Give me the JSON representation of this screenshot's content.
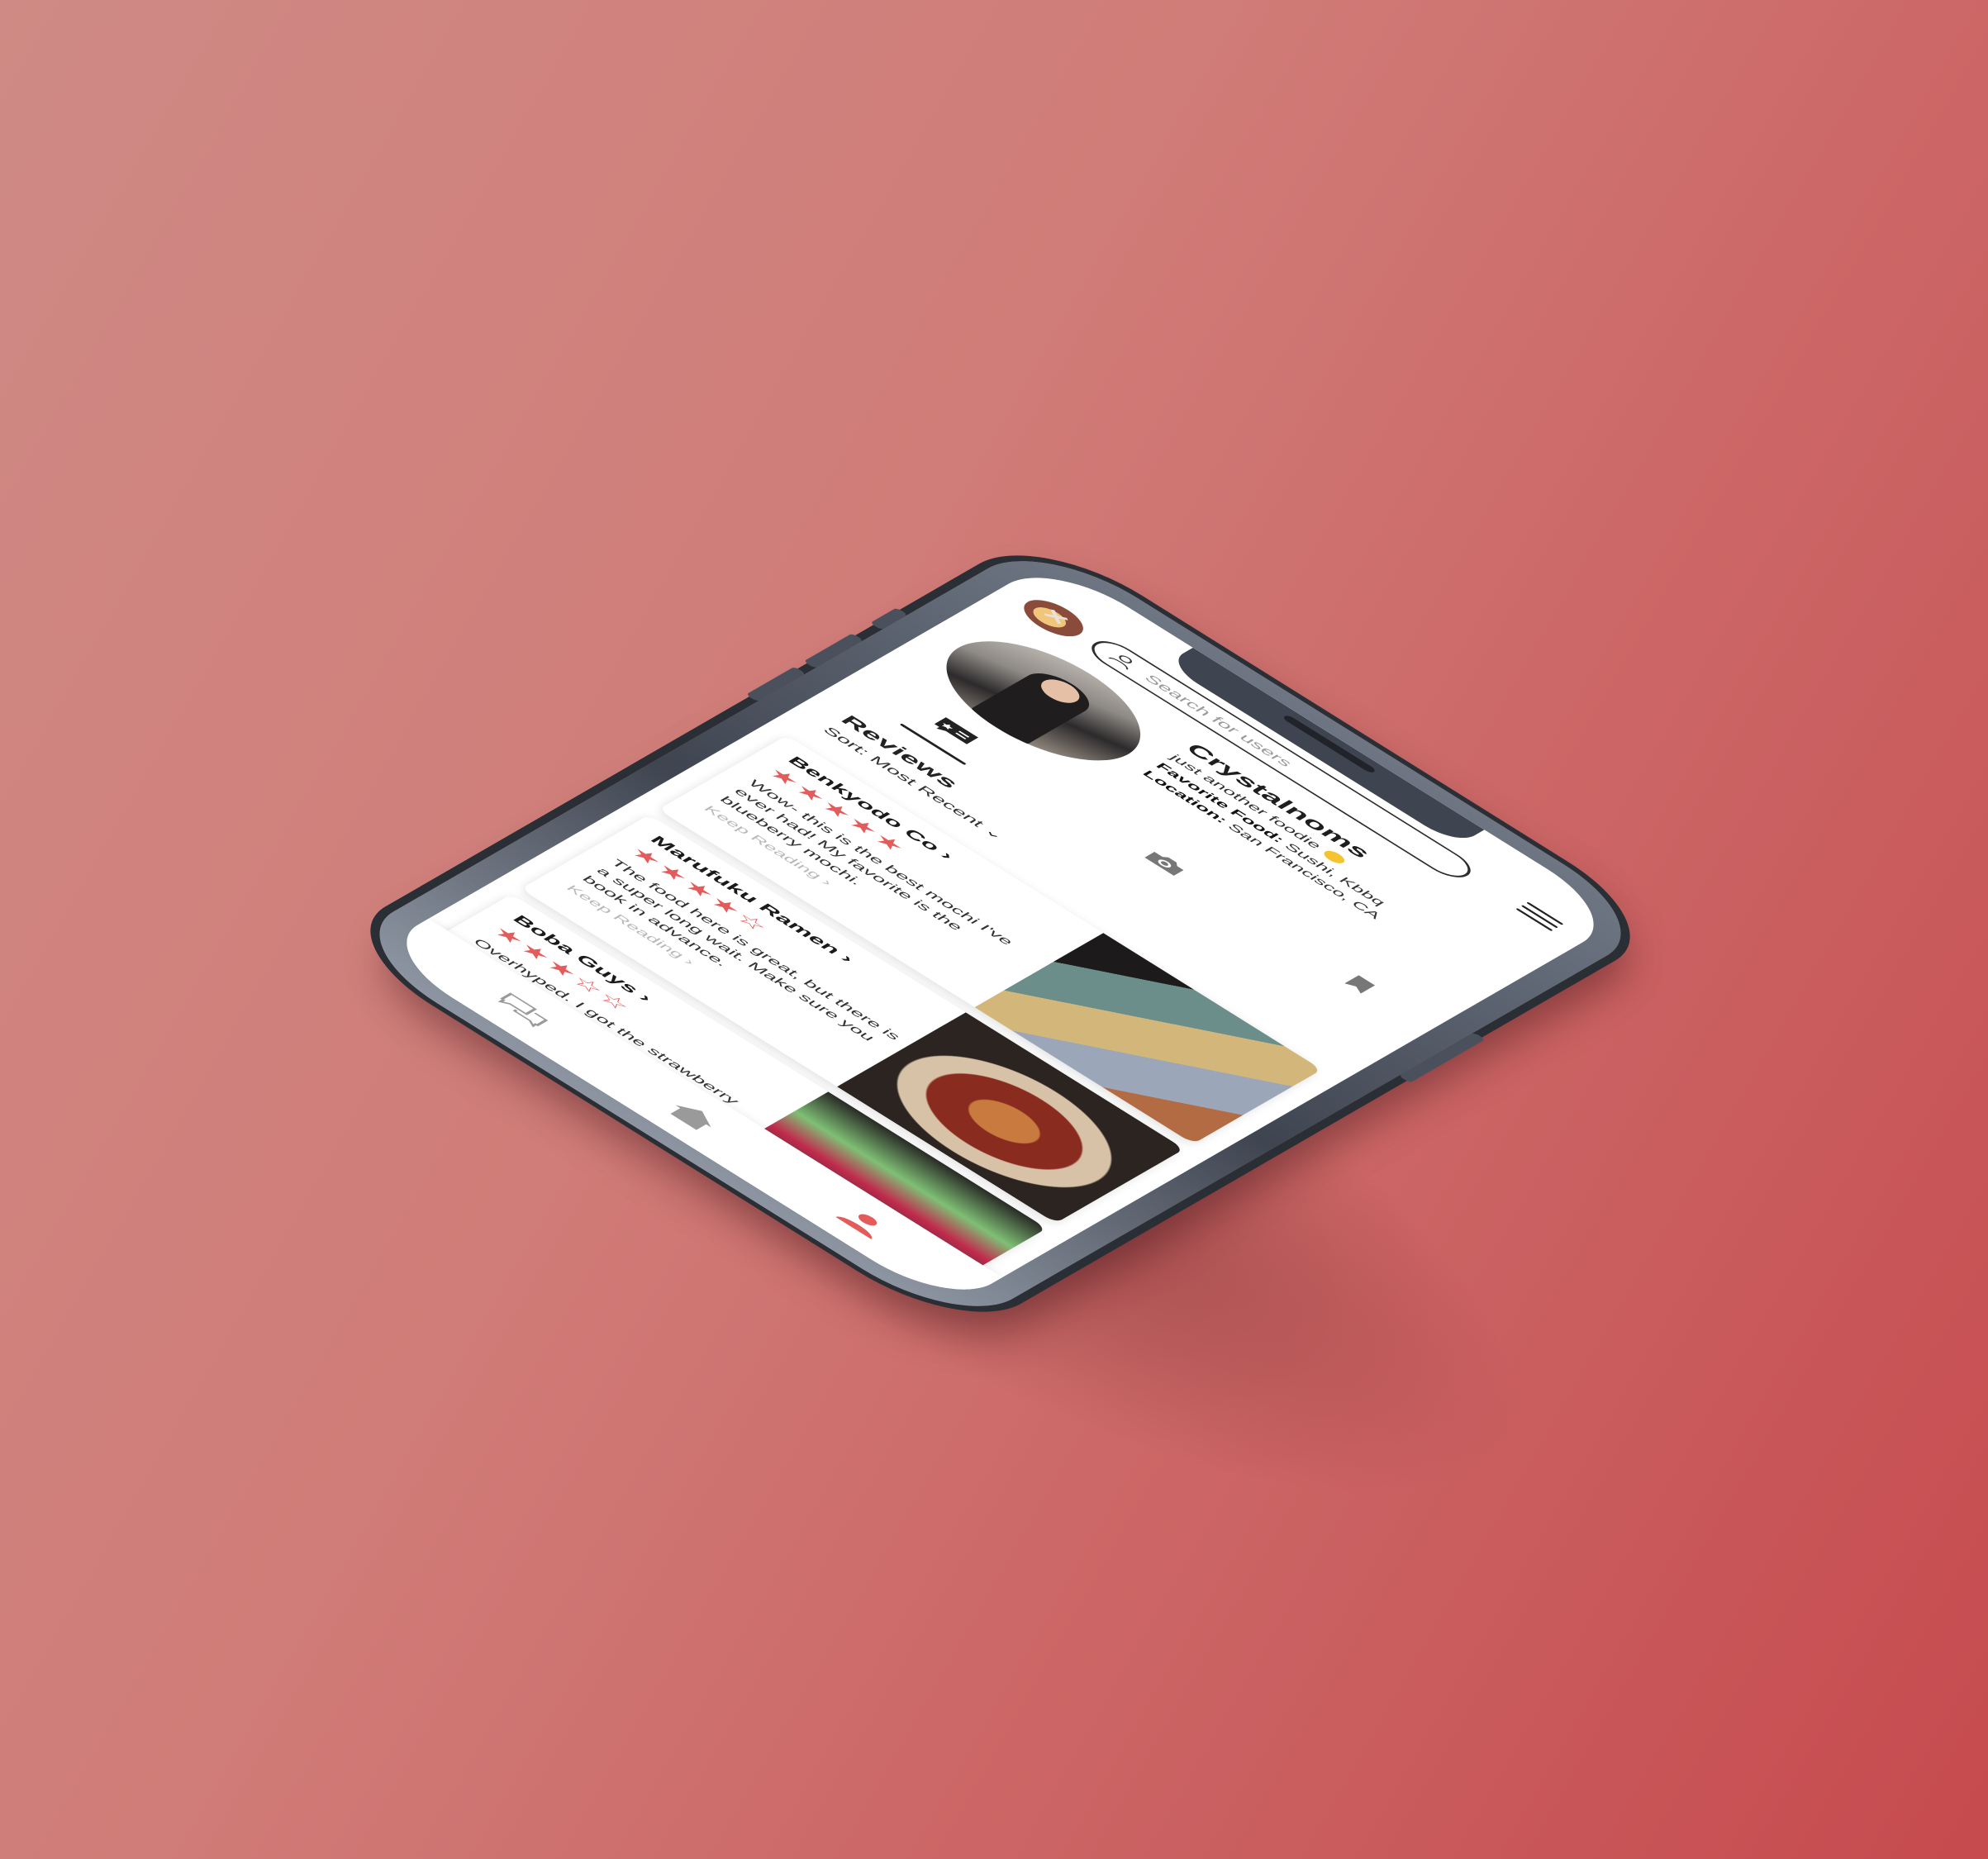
{
  "search": {
    "placeholder": "Search for users"
  },
  "profile": {
    "username": "Crystalnoms",
    "bio": "just another foodie",
    "favorite_food_label": "Favorite Food:",
    "favorite_food_value": "Sushi, Kbbq",
    "location_label": "Location:",
    "location_value": "San Francisco, CA"
  },
  "reviews_section": {
    "title": "Reviews",
    "sort_label": "Sort: Most Recent"
  },
  "reviews": [
    {
      "name": "Benkyodo Co",
      "rating": 5,
      "stars": "★★★★★",
      "text": "Wow- this is the best mochi I've ever had! My favorite is the blueberry mochi.",
      "more": "Keep Reading"
    },
    {
      "name": "Marufuku Ramen",
      "rating": 4,
      "stars": "★★★★☆",
      "text": "The food here is great, but there is a super long wait. Make sure you book in advance.",
      "more": "Keep Reading"
    },
    {
      "name": "Boba Guys",
      "rating": 3,
      "stars": "★★★☆☆",
      "text": "Overhyped. I got the strawberry matcha latte with tapioca but felt like it was too sweet."
    }
  ],
  "colors": {
    "accent": "#e35b5b",
    "background": "#cf7a76"
  },
  "icons": {
    "search": "user-search-icon",
    "menu": "hamburger-menu-icon",
    "saved": "bookmark-icon",
    "photos": "camera-icon",
    "reviews": "review-card-icon",
    "messages": "chat-icon",
    "home": "home-icon",
    "profile": "profile-icon"
  }
}
